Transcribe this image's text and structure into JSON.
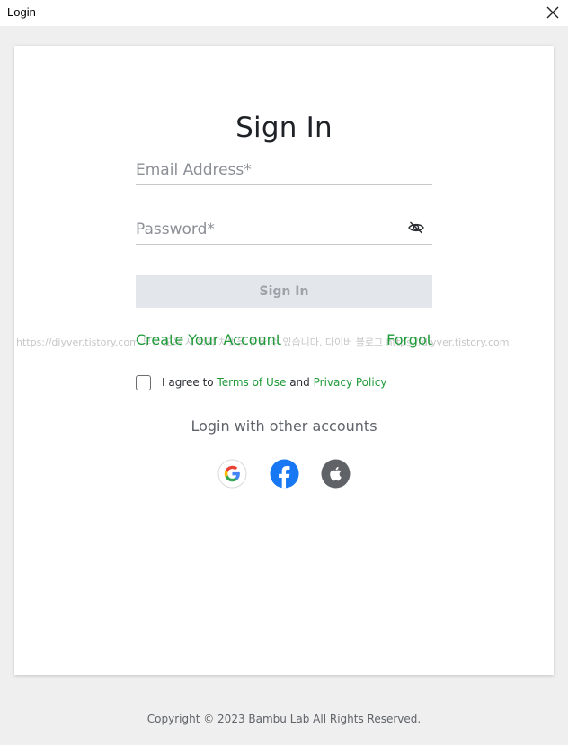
{
  "window": {
    "title": "Login",
    "close_icon": "close-icon"
  },
  "form": {
    "heading": "Sign In",
    "email_placeholder": "Email Address*",
    "email_value": "",
    "password_placeholder": "Password*",
    "password_value": "",
    "password_toggle_icon": "eye-slash-icon",
    "submit_label": "Sign In",
    "create_account_label": "Create Your Account",
    "forgot_label": "Forgot"
  },
  "watermark": {
    "text": "https://diyver.tistory.com  무단 도용 시 법적 처벌을 받을 수 있습니다. 다이버 블로그    https://diyver.tistory.com"
  },
  "agreement": {
    "checked": false,
    "prefix": "I agree to ",
    "terms_label": "Terms of Use",
    "and_text": " and ",
    "privacy_label": "Privacy Policy"
  },
  "social": {
    "divider_label": "Login with other accounts",
    "providers": [
      {
        "name": "google",
        "icon": "google-icon"
      },
      {
        "name": "facebook",
        "icon": "facebook-icon",
        "color": "#1877f2"
      },
      {
        "name": "apple",
        "icon": "apple-icon",
        "color": "#5f6368"
      }
    ]
  },
  "footer": {
    "copyright": "Copyright © 2023 Bambu Lab All Rights Reserved."
  },
  "colors": {
    "accent": "#1f9b3a",
    "button_disabled_bg": "#e3e6ea",
    "button_disabled_text": "#9ea3a9"
  }
}
